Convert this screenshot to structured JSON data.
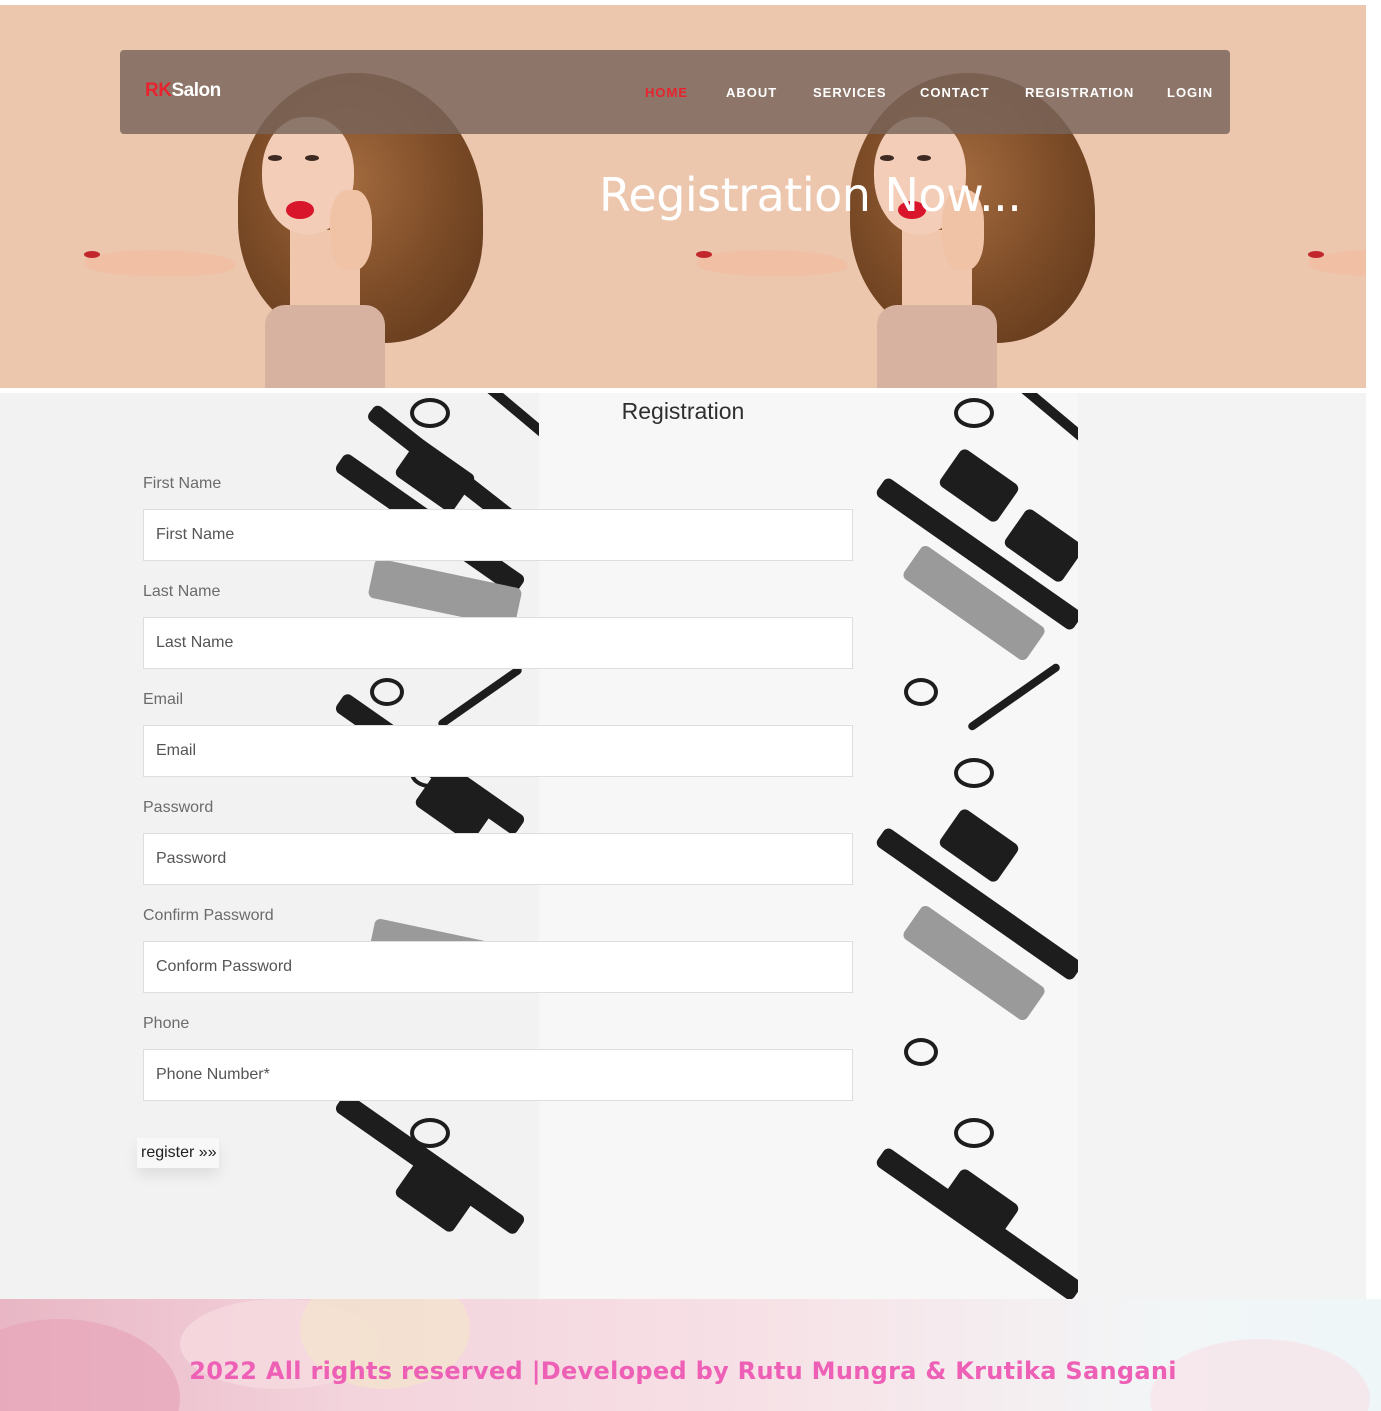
{
  "brand": {
    "prefix": "RK",
    "name": "Salon"
  },
  "nav": {
    "items": [
      {
        "label": "HOME",
        "active": true
      },
      {
        "label": "ABOUT",
        "active": false
      },
      {
        "label": "SERVICES",
        "active": false
      },
      {
        "label": "CONTACT",
        "active": false
      },
      {
        "label": "REGISTRATION",
        "active": false
      },
      {
        "label": "LOGIN",
        "active": false
      }
    ]
  },
  "hero": {
    "title": "Registration Now..."
  },
  "form": {
    "title": "Registration",
    "fields": [
      {
        "label": "First Name",
        "placeholder": "First Name",
        "value": ""
      },
      {
        "label": "Last Name",
        "placeholder": "Last Name",
        "value": ""
      },
      {
        "label": "Email",
        "placeholder": "Email",
        "value": ""
      },
      {
        "label": "Password",
        "placeholder": "Password",
        "value": ""
      },
      {
        "label": "Confirm Password",
        "placeholder": "Conform Password",
        "value": ""
      },
      {
        "label": "Phone",
        "placeholder": "Phone Number*",
        "value": ""
      }
    ],
    "submit_label": "register »»"
  },
  "footer": {
    "text": "2022 All rights reserved |Developed by Rutu Mungra & Krutika Sangani"
  },
  "colors": {
    "accent_red": "#e8222e",
    "footer_pink": "#ee5fb6",
    "hero_bg": "#ecc7ae"
  }
}
